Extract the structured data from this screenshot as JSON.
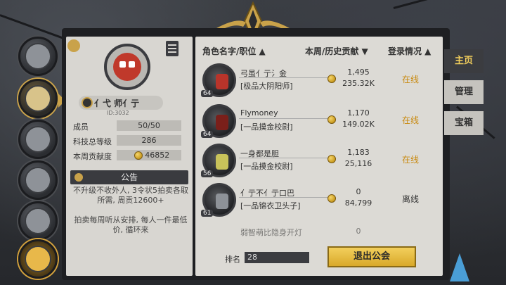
{
  "guild": {
    "name": "亻弋 师亻亍",
    "id": "ID:3032",
    "stats": [
      {
        "label": "成员",
        "value": "50/50"
      },
      {
        "label": "科技总等级",
        "value": "286"
      },
      {
        "label": "本周贡献度",
        "value": "46852"
      }
    ],
    "notice_title": "公告",
    "notice_text": "不升级不收外人, 3令状5拍卖各取所需, 周贡12600+\n\n拍卖每周听从安排, 每人一件最低价, 循环来"
  },
  "table": {
    "headers": {
      "name": "角色名字/职位 ▲",
      "contrib": "本周/历史贡献 ▼",
      "status": "登录情况 ▲"
    },
    "rows": [
      {
        "name": "弓虽亻亍氵金",
        "title": "[极品大阴阳师]",
        "level": "64",
        "week": "1,495",
        "total": "235.32K",
        "status": "在线"
      },
      {
        "name": "Flymoney",
        "title": "[一品摸金校尉]",
        "level": "64",
        "week": "1,170",
        "total": "149.02K",
        "status": "在线"
      },
      {
        "name": "一身都是胆",
        "title": "[一品摸金校尉]",
        "level": "56",
        "week": "1,183",
        "total": "25,116",
        "status": "在线"
      },
      {
        "name": "亻亍不亻亍口巴",
        "title": "[一品锦衣卫头子]",
        "level": "61",
        "week": "0",
        "total": "84,799",
        "status": "离线"
      },
      {
        "name": "弱智萌比隐身开灯",
        "title": "",
        "level": "",
        "week": "0",
        "total": "",
        "status": ""
      }
    ]
  },
  "rank_label": "排名",
  "rank_value": "28",
  "leave_button": "退出公会",
  "tabs": [
    "主页",
    "管理",
    "宝箱"
  ],
  "colors": {
    "online": "#c98a10",
    "offline": "#333333",
    "accent": "#f3cf5c"
  }
}
